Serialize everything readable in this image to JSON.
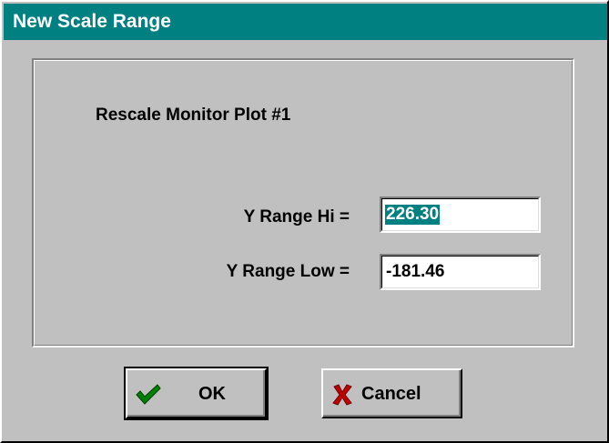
{
  "window": {
    "title": "New Scale Range"
  },
  "group": {
    "heading": "Rescale Monitor Plot #1"
  },
  "fields": {
    "y_range_hi": {
      "label": "Y Range Hi =",
      "value": "226.30",
      "selected": true
    },
    "y_range_low": {
      "label": "Y Range Low =",
      "value": "-181.46",
      "selected": false
    }
  },
  "buttons": {
    "ok": {
      "label": "OK",
      "icon": "checkmark-icon",
      "icon_color": "#008000"
    },
    "cancel": {
      "label": "Cancel",
      "icon": "x-mark-icon",
      "icon_color": "#c00000"
    }
  },
  "colors": {
    "titlebar": "#008080",
    "face": "#c0c0c0",
    "selection": "#008080"
  }
}
